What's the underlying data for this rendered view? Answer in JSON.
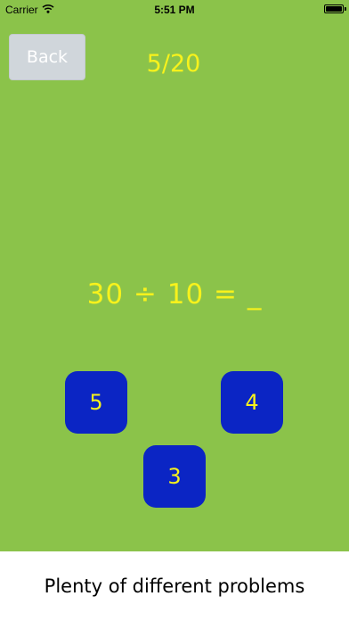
{
  "status_bar": {
    "carrier": "Carrier",
    "time": "5:51 PM",
    "icons": [
      "wifi-icon",
      "battery-icon"
    ]
  },
  "header": {
    "back_label": "Back",
    "progress": "5/20"
  },
  "problem": {
    "text": "30 ÷ 10 = _"
  },
  "answers": [
    "5",
    "4",
    "3"
  ],
  "caption": "Plenty of different problems",
  "colors": {
    "background": "#8bc34a",
    "text_yellow": "#f7f21c",
    "answer_button": "#0b25c4",
    "back_button": "#d0d6db"
  }
}
